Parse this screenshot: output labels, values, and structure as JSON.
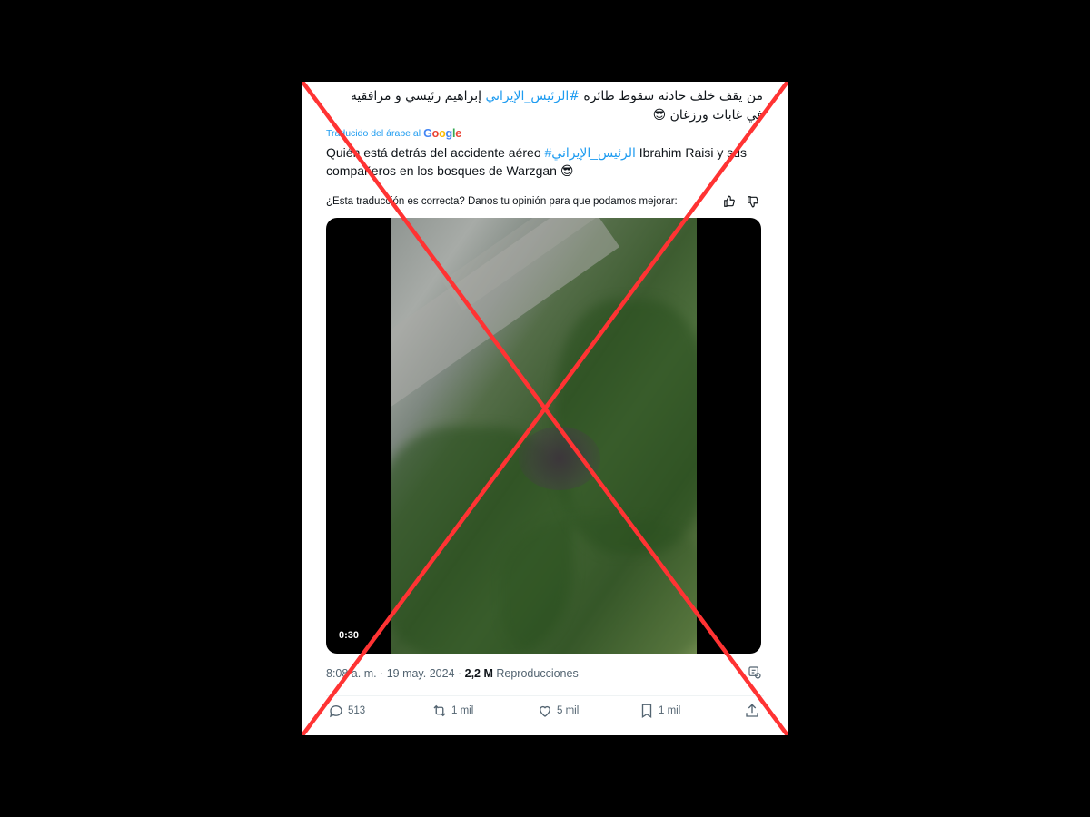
{
  "tweet": {
    "arabic_line1_prefix": "من يقف خلف حادثة سقوط طائرة ",
    "arabic_hashtag": "#الرئيس_الإيراني",
    "arabic_line1_suffix": " إبراهيم رئيسي و مرافقيه في غابات ورزغان 😎",
    "translated_label": "Traducido del árabe al",
    "google_letters": [
      "G",
      "o",
      "o",
      "g",
      "l",
      "e"
    ],
    "translation_prefix": "Quién está detrás del accidente aéreo ",
    "translation_hashtag": "#الرئيس_الإيراني",
    "translation_suffix": " Ibrahim Raisi y sus compañeros en los bosques de Warzgan 😎",
    "feedback_question": "¿Esta traducción es correcta? Danos tu opinión para que podamos mejorar:",
    "video_duration": "0:30",
    "timestamp": "8:08 a. m. · 19 may. 2024 · ",
    "views_count": "2,2 M",
    "views_label": " Reproducciones"
  },
  "actions": {
    "replies": "513",
    "reposts": "1 mil",
    "likes": "5 mil",
    "bookmarks": "1 mil"
  },
  "colors": {
    "accent": "#1d9bf0",
    "cross": "#ff3333",
    "muted_text": "#536471"
  },
  "icons": [
    "thumbs-up-icon",
    "thumbs-down-icon",
    "reply-icon",
    "repost-icon",
    "like-icon",
    "bookmark-icon",
    "share-icon",
    "grok-icon"
  ]
}
